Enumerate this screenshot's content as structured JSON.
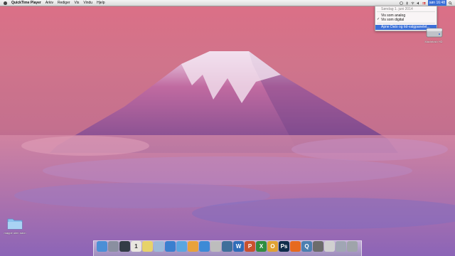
{
  "menubar": {
    "app_name": "QuickTime Player",
    "menus": [
      "Arkiv",
      "Rediger",
      "Vis",
      "Vindu",
      "Hjelp"
    ],
    "clock_text": "søn 16:48"
  },
  "clock_menu": {
    "date": "Søndag 1. juni 2014",
    "analog": "Vis som analog",
    "digital": "Vis som digital",
    "open_prefs": "Åpne Dato og tid-valgpanelet..."
  },
  "desktop": {
    "hd_label": "Macintosh HD",
    "folder_label": "mappe uten navn"
  },
  "dock": {
    "items": [
      {
        "name": "finder-icon",
        "glyph": "",
        "color": "#4b8fd6"
      },
      {
        "name": "rocket-icon",
        "glyph": "",
        "color": "#8a8fa0"
      },
      {
        "name": "mission-control-icon",
        "glyph": "",
        "color": "#333c46"
      },
      {
        "name": "calendar-icon",
        "glyph": "1",
        "color": "#e9e6e0"
      },
      {
        "name": "notes-icon",
        "glyph": "",
        "color": "#e7d36a"
      },
      {
        "name": "preview-icon",
        "glyph": "",
        "color": "#9cbad9"
      },
      {
        "name": "safari-icon",
        "glyph": "",
        "color": "#3a7fcf"
      },
      {
        "name": "itunes-icon",
        "glyph": "",
        "color": "#5aa6e0"
      },
      {
        "name": "folder-icon",
        "glyph": "",
        "color": "#e8a23b"
      },
      {
        "name": "appstore-icon",
        "glyph": "",
        "color": "#3d8ad6"
      },
      {
        "name": "chess-icon",
        "glyph": "",
        "color": "#bdbdbd"
      },
      {
        "name": "tools-icon",
        "glyph": "",
        "color": "#3f6f9a"
      },
      {
        "name": "word-icon",
        "glyph": "W",
        "color": "#2f6cb8"
      },
      {
        "name": "powerpoint-icon",
        "glyph": "P",
        "color": "#c9512e"
      },
      {
        "name": "excel-icon",
        "glyph": "X",
        "color": "#2f8d3f"
      },
      {
        "name": "outlook-icon",
        "glyph": "O",
        "color": "#e0a233"
      },
      {
        "name": "photoshop-icon",
        "glyph": "Ps",
        "color": "#0e2c4a"
      },
      {
        "name": "firefox-icon",
        "glyph": "",
        "color": "#e66a1f"
      },
      {
        "name": "quicktime-icon",
        "glyph": "Q",
        "color": "#4b7fb0"
      },
      {
        "name": "display-icon",
        "glyph": "",
        "color": "#6c6c6c"
      },
      {
        "name": "keyboard-icon",
        "glyph": "",
        "color": "#d0d0d0"
      },
      {
        "name": "downloads-icon",
        "glyph": "",
        "color": "#a0a6b4"
      },
      {
        "name": "trash-icon",
        "glyph": "",
        "color": "#9fa4aa"
      }
    ]
  }
}
